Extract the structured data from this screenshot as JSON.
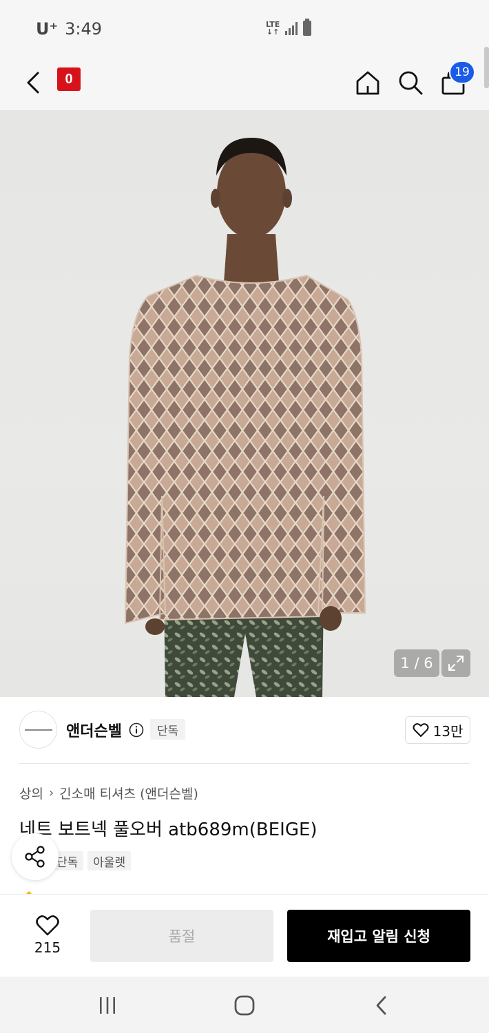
{
  "status_bar": {
    "carrier": "U⁺",
    "time": "3:49",
    "network": "LTE"
  },
  "header": {
    "brand_logo_text": "0",
    "cart_count": "19",
    "icons": [
      "back-arrow-icon",
      "home-icon",
      "search-icon",
      "shopping-bag-icon"
    ]
  },
  "gallery": {
    "counter": "1 / 6",
    "current": 1,
    "total": 6
  },
  "brand": {
    "name": "앤더슨벨",
    "badge": "단독",
    "likes": "13만"
  },
  "breadcrumb": {
    "category": "상의",
    "subcategory": "긴소매 티셔츠 (앤더슨벨)"
  },
  "product": {
    "title": "네트 보트넥 풀오버 atb689m(BEIGE)",
    "tags": [
      "단독",
      "아울렛"
    ]
  },
  "bottom_bar": {
    "wish_count": "215",
    "soldout_label": "품절",
    "restock_label": "재입고 알림 신청"
  },
  "colors": {
    "brand_red": "#d7121b",
    "badge_blue": "#1a5be8",
    "cta_black": "#000000"
  }
}
